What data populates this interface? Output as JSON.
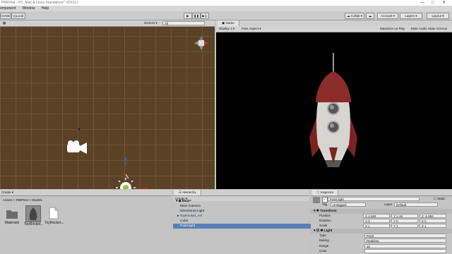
{
  "window": {
    "title": "PBRTest - PC, Mac & Linux Standalone* <DX11>",
    "controls": [
      "—",
      "□",
      "✕"
    ]
  },
  "menu": [
    "omponent",
    "Window",
    "Help"
  ],
  "toolbar": {
    "pivot_label": "Center",
    "space_label": "Local",
    "collab_label": "Collab",
    "account_label": "Account",
    "layers_label": "Layers",
    "layout_label": "Layout"
  },
  "scene": {
    "gizmos_label": "Gizmos",
    "search_placeholder": "All",
    "orientation_label": "Top"
  },
  "game": {
    "tab_label": "Game",
    "display_label": "Display 1",
    "aspect_label": "Free Aspect",
    "maximize_label": "Maximize on Play",
    "mute_label": "Mute Audio",
    "stats_label": "Stats",
    "gizmos_label": "Gizmos"
  },
  "project": {
    "create_label": "Create",
    "breadcrumb": "Assets > PBRTest > Models",
    "items": [
      {
        "label": "Materials",
        "icon": "folder-icon"
      },
      {
        "label": "ToyRocket...",
        "icon": "model-icon"
      },
      {
        "label": "ToyRocket...",
        "icon": "document-icon"
      }
    ]
  },
  "hierarchy": {
    "tab_label": "Hierarchy",
    "create_label": "Create",
    "scene_name": "Main*",
    "items": [
      {
        "label": "Main Camera",
        "indent": 1,
        "selected": false
      },
      {
        "label": "Directional Light",
        "indent": 1,
        "selected": false
      },
      {
        "label": "ToyRocket_AH",
        "indent": 1,
        "selected": false,
        "expandable": true
      },
      {
        "label": "Cube",
        "indent": 1,
        "selected": false
      },
      {
        "label": "Point light",
        "indent": 1,
        "selected": true
      }
    ]
  },
  "inspector": {
    "tab_label": "Inspector",
    "object_name": "Point light",
    "static_label": "Static",
    "tag_label": "Tag",
    "tag_value": "Untagged",
    "layer_label": "Layer",
    "layer_value": "Default",
    "transform": {
      "title": "Transform",
      "position": {
        "label": "Position",
        "x": "X 1.528",
        "y": "Y 1.19",
        "z": "Z -1.594"
      },
      "rotation": {
        "label": "Rotation",
        "x": "X 0",
        "y": "Y 0",
        "z": "Z 0"
      },
      "scale": {
        "label": "Scale",
        "x": "X 1",
        "y": "Y 1",
        "z": "Z 1"
      }
    },
    "light": {
      "title": "Light",
      "type_label": "Type",
      "type_value": "Point",
      "baking_label": "Baking",
      "baking_value": "Realtime",
      "range_label": "Range",
      "range_value": "10",
      "color_label": "Color"
    }
  },
  "colors": {
    "scene_bg": "#5a4226",
    "game_bg": "#000000",
    "selection": "#5a7fb6",
    "rocket_red": "#8b2c28"
  }
}
